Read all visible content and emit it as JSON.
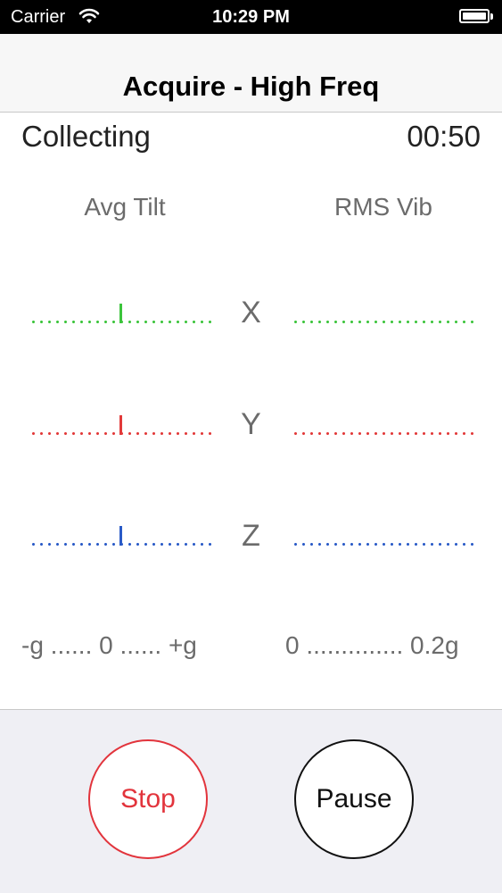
{
  "status_bar": {
    "carrier": "Carrier",
    "time": "10:29 PM",
    "wifi_icon": "wifi-icon",
    "battery_icon": "battery-icon"
  },
  "nav": {
    "title": "Acquire - High Freq"
  },
  "collection": {
    "state": "Collecting",
    "elapsed": "00:50"
  },
  "columns": {
    "left": "Avg Tilt",
    "right": "RMS Vib"
  },
  "axes": [
    {
      "label": "X",
      "color": "#3cc43c",
      "tilt_value": 0.0,
      "vib_value": 0.0
    },
    {
      "label": "Y",
      "color": "#e23a3a",
      "tilt_value": 0.0,
      "vib_value": 0.0
    },
    {
      "label": "Z",
      "color": "#2a5bc7",
      "tilt_value": 0.0,
      "vib_value": 0.0
    }
  ],
  "scales": {
    "tilt": "-g ...... 0 ...... +g",
    "vib": "0 .............. 0.2g"
  },
  "buttons": {
    "stop": "Stop",
    "pause": "Pause"
  }
}
